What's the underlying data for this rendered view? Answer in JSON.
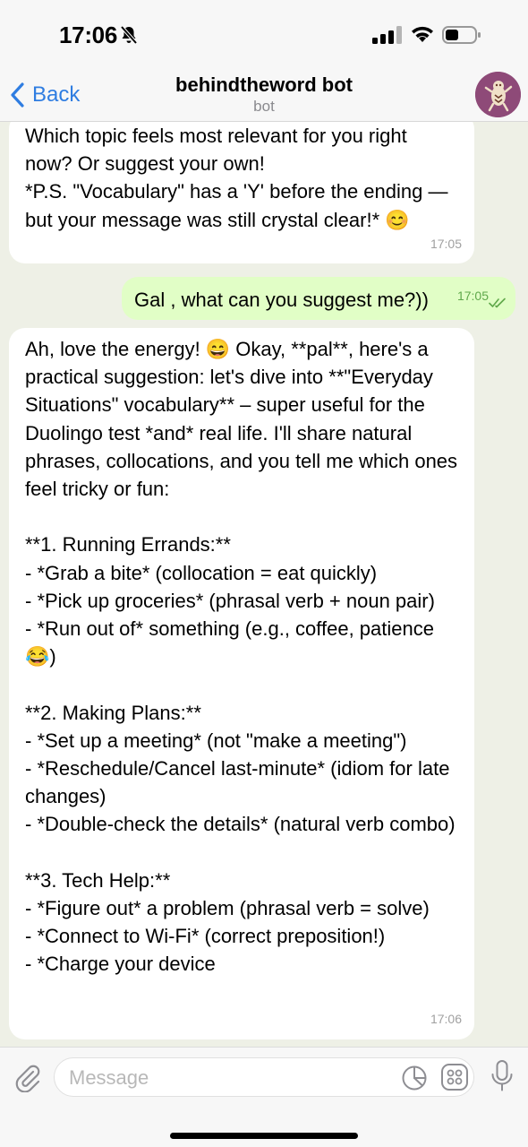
{
  "status_bar": {
    "time": "17:06",
    "icons": [
      "bell-slash-icon",
      "signal-icon",
      "wifi-icon",
      "battery-icon"
    ]
  },
  "header": {
    "back_label": "Back",
    "title": "behindtheword bot",
    "subtitle": "bot",
    "accent_color": "#2f7de1"
  },
  "messages": [
    {
      "direction": "incoming",
      "text": "Which topic feels most relevant for you right now? Or suggest your own!\n*P.S. \"Vocabulary\" has a 'Y' before the ending — but your message was still crystal clear!* 😊",
      "time": "17:05"
    },
    {
      "direction": "outgoing",
      "text": "Gal , what can you suggest me?))",
      "time": "17:05",
      "status": "read"
    },
    {
      "direction": "incoming",
      "text": "Ah, love the energy! 😄 Okay, **pal**, here's a practical suggestion: let's dive into **\"Everyday Situations\" vocabulary** – super useful for the Duolingo test *and* real life. I'll share natural phrases, collocations, and you tell me which ones feel tricky or fun:\n\n**1. Running Errands:**\n- *Grab a bite* (collocation = eat quickly)\n- *Pick up groceries* (phrasal verb + noun pair)\n- *Run out of* something (e.g., coffee, patience 😂)\n\n**2. Making Plans:**\n- *Set up a meeting* (not \"make a meeting\")\n- *Reschedule/Cancel last-minute* (idiom for late changes)\n- *Double-check the details* (natural verb combo)\n\n**3. Tech Help:**\n- *Figure out* a problem (phrasal verb = solve)\n- *Connect to Wi-Fi* (correct preposition!)\n- *Charge your device",
      "time": "17:06"
    }
  ],
  "input": {
    "placeholder": "Message"
  },
  "colors": {
    "chat_background": "#eef0e6",
    "incoming_bubble": "#ffffff",
    "outgoing_bubble": "#e1fec6",
    "read_check": "#5fa84a"
  }
}
